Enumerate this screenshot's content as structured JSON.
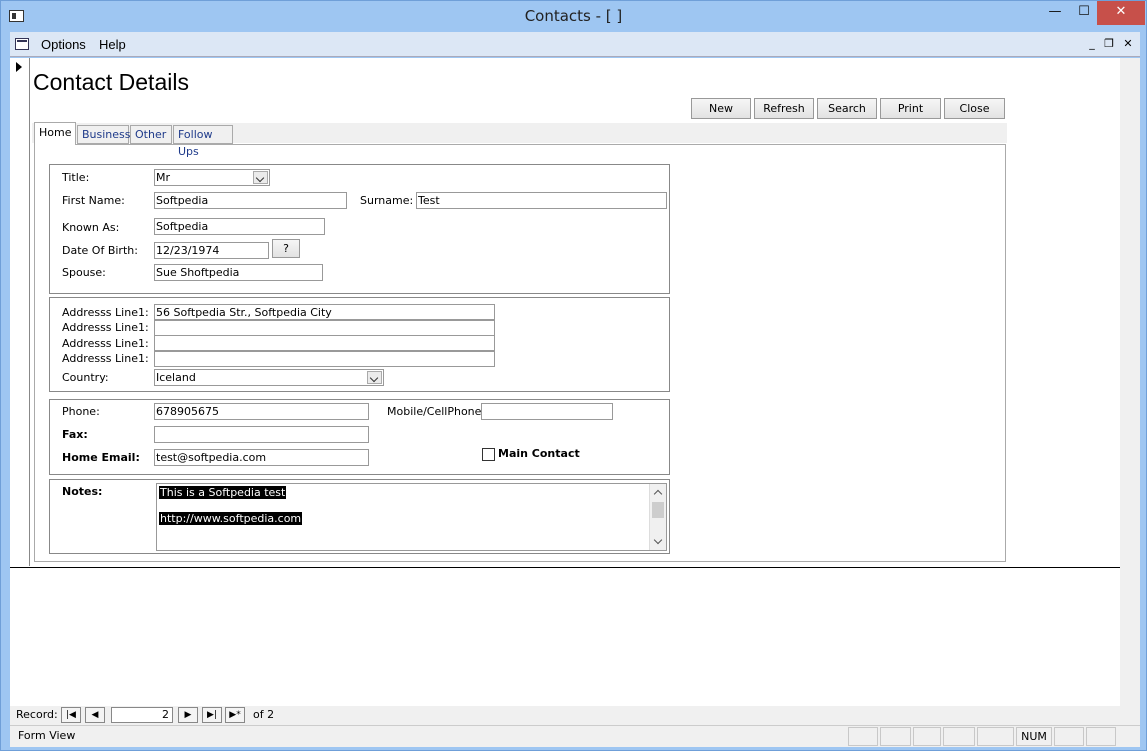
{
  "window": {
    "title": "Contacts - [ ]",
    "min_glyph": "—",
    "max_glyph": "☐",
    "close_glyph": "✕"
  },
  "menu": {
    "items": [
      {
        "label": "Options",
        "accel": "O"
      },
      {
        "label": "Help",
        "accel": "H"
      }
    ],
    "mdi_min": "_",
    "mdi_restore": "❐",
    "mdi_close": "✕"
  },
  "form": {
    "title": "Contact Details",
    "buttons": [
      "New",
      "Refresh",
      "Search",
      "Print",
      "Close"
    ],
    "tabs": [
      "Home",
      "Business",
      "Other",
      "Follow Ups"
    ],
    "active_tab": "Home"
  },
  "personal": {
    "title_label": "Title:",
    "title_value": "Mr",
    "first_name_label": "First Name:",
    "first_name": "Softpedia",
    "surname_label": "Surname:",
    "surname": "Test",
    "known_as_label": "Known As:",
    "known_as": "Softpedia",
    "dob_label": "Date Of Birth:",
    "dob": "12/23/1974",
    "dob_button": "?",
    "spouse_label": "Spouse:",
    "spouse": "Sue Shoftpedia"
  },
  "address": {
    "lines": [
      {
        "label": "Addresss Line1:",
        "value": "56 Softpedia Str.,  Softpedia City"
      },
      {
        "label": "Addresss Line1:",
        "value": ""
      },
      {
        "label": "Addresss Line1:",
        "value": ""
      },
      {
        "label": "Addresss Line1:",
        "value": ""
      }
    ],
    "country_label": "Country:",
    "country": "Iceland"
  },
  "contact": {
    "phone_label": "Phone:",
    "phone": "678905675",
    "mobile_label": "Mobile/CellPhone:",
    "mobile": "",
    "fax_label": "Fax:",
    "fax": "",
    "email_label": "Home Email:",
    "email": "test@softpedia.com",
    "main_contact_label": "Main Contact",
    "main_contact_checked": false
  },
  "notes": {
    "label": "Notes:",
    "line1": "This is a  Softpedia test",
    "line2": "http://www.softpedia.com"
  },
  "navigation": {
    "record_label": "Record:",
    "current": "2",
    "of_label": "of 2",
    "first": "|◀",
    "prev": "◀",
    "next": "▶",
    "last": "▶|",
    "new": "▶*"
  },
  "status": {
    "view": "Form View",
    "num": "NUM"
  }
}
